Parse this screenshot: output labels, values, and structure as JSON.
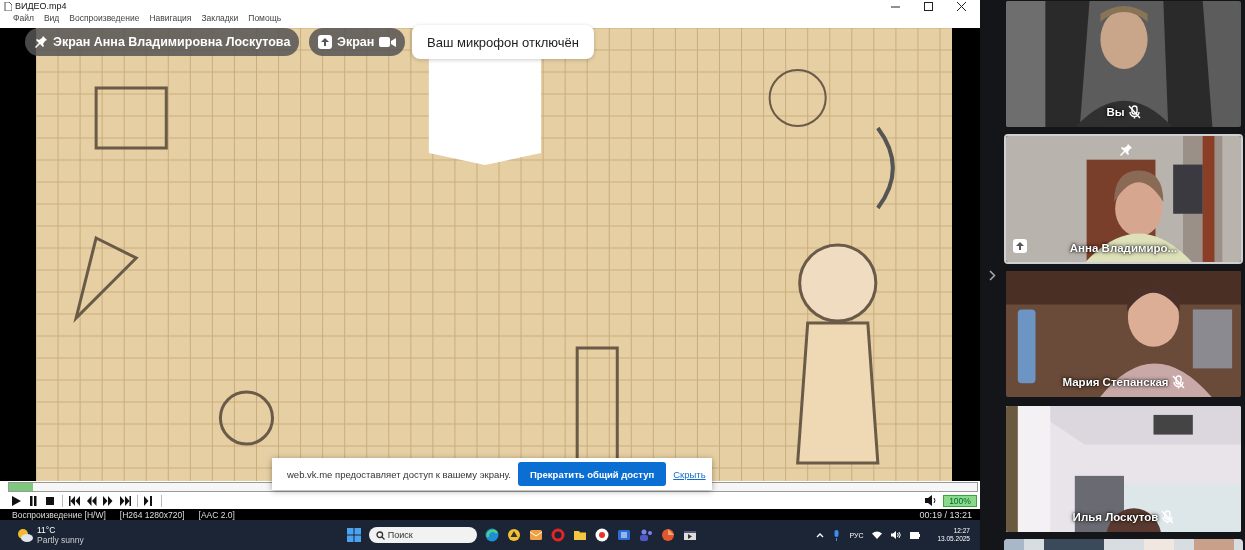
{
  "player": {
    "title": "ВИДЕО.mp4",
    "menu": [
      "Файл",
      "Вид",
      "Воспроизведение",
      "Навигация",
      "Закладки",
      "Помощь"
    ],
    "video": {
      "kind": "picture"
    },
    "seek": {
      "level": 0.025
    },
    "volume": {
      "level": 1,
      "reading": "100%"
    },
    "status": [
      "Воспроизведение [H/W]",
      "[H264 1280x720]",
      "[AAC 2.0]"
    ],
    "time": "00:19 / 13:21"
  },
  "call_overlay": {
    "pinned_screen": "Экран Анна Владимировна Лоскутова",
    "screen": "Экран",
    "mic_notice": "Ваш микрофон отключён"
  },
  "share_bar": {
    "message": "web.vk.me предоставляет доступ к вашему экрану.",
    "stop_button": "Прекратить общий доступ",
    "hide_link": "Скрыть"
  },
  "taskbar": {
    "temperature": "11°C",
    "weather": "Partly sunny",
    "search": {
      "placeholder": "Поиск"
    },
    "language": "РУС",
    "time": "12:27",
    "date": "13.05.2025"
  },
  "participants": [
    {
      "name": "Вы",
      "muted": true,
      "pinned": false,
      "sharing": false,
      "selected": false
    },
    {
      "name": "Анна Владимиро...",
      "muted": false,
      "pinned": true,
      "sharing": true,
      "selected": true
    },
    {
      "name": "Мария Степанская",
      "muted": true,
      "pinned": false,
      "sharing": false,
      "selected": false
    },
    {
      "name": "Илья Лоскутов",
      "muted": true,
      "pinned": false,
      "sharing": false,
      "selected": false
    }
  ],
  "more_tile": {
    "kind": "picture"
  }
}
